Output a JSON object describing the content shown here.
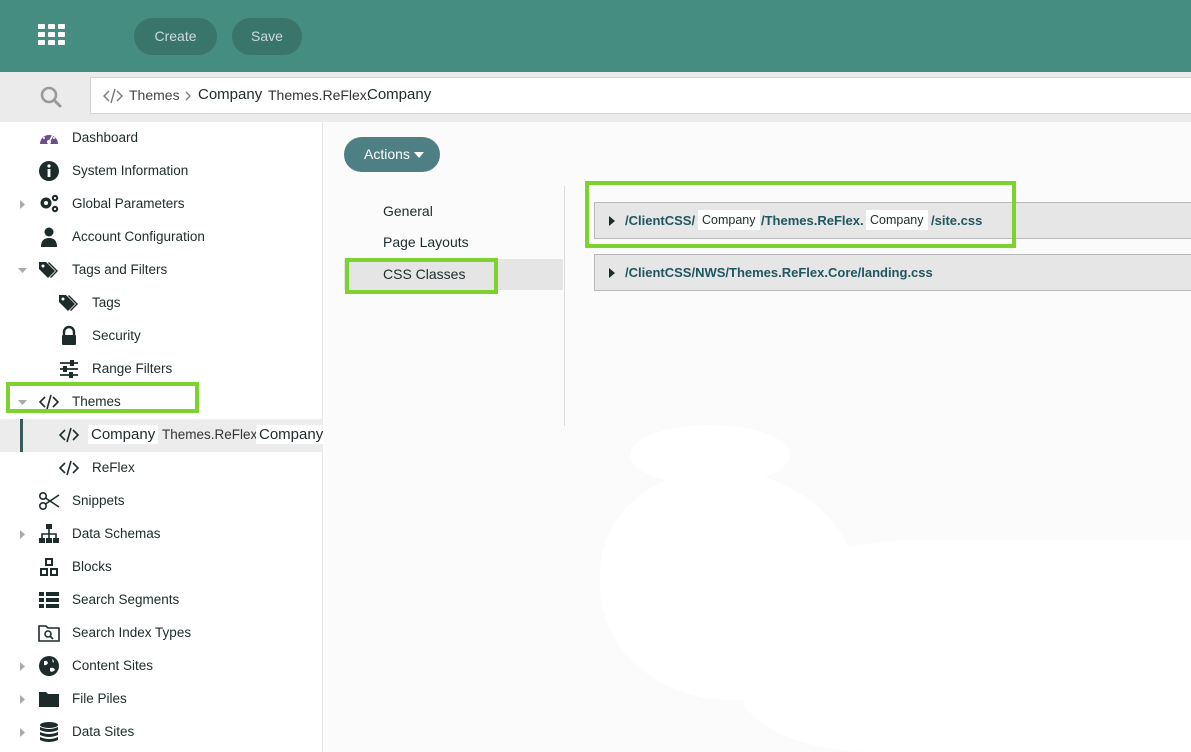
{
  "toolbar": {
    "create_label": "Create",
    "save_label": "Save"
  },
  "breadcrumb": {
    "item1": "Themes",
    "item2_a": "Company",
    "item2_b": "Themes.ReFlex.",
    "item2_c": "Company"
  },
  "sidebar": {
    "items": [
      {
        "label": "Dashboard",
        "icon": "dashboard-icon"
      },
      {
        "label": "System Information",
        "icon": "info-icon"
      },
      {
        "label": "Global Parameters",
        "icon": "gears-icon"
      },
      {
        "label": "Account Configuration",
        "icon": "user-icon"
      },
      {
        "label": "Tags and Filters",
        "icon": "tags-icon"
      },
      {
        "label": "Tags",
        "icon": "tags-icon"
      },
      {
        "label": "Security",
        "icon": "lock-icon"
      },
      {
        "label": "Range Filters",
        "icon": "sliders-icon"
      },
      {
        "label": "Themes",
        "icon": "code-icon"
      },
      {
        "label_a": "Company",
        "label_b": "Themes.ReFlex.",
        "label_c": "Company",
        "icon": "code-icon"
      },
      {
        "label": "ReFlex",
        "icon": "code-icon"
      },
      {
        "label": "Snippets",
        "icon": "scissors-icon"
      },
      {
        "label": "Data Schemas",
        "icon": "sitemap-icon"
      },
      {
        "label": "Blocks",
        "icon": "cubes-icon"
      },
      {
        "label": "Search Segments",
        "icon": "list-icon"
      },
      {
        "label": "Search Index Types",
        "icon": "search-folder-icon"
      },
      {
        "label": "Content Sites",
        "icon": "globe-icon"
      },
      {
        "label": "File Piles",
        "icon": "folder-icon"
      },
      {
        "label": "Data Sites",
        "icon": "database-icon"
      }
    ]
  },
  "main": {
    "actions_label": "Actions",
    "tabs": [
      {
        "label": "General"
      },
      {
        "label": "Page Layouts"
      },
      {
        "label": "CSS Classes"
      }
    ],
    "files": [
      {
        "prefix": "/ClientCSS/",
        "mask1": "Company",
        "middle": "/Themes.ReFlex.",
        "mask2": "Company",
        "suffix": "/site.css"
      },
      {
        "path": "/ClientCSS/NWS/Themes.ReFlex.Core/landing.css"
      }
    ]
  },
  "colors": {
    "header": "#468d81",
    "header_button": "#3a7569",
    "actions_button": "#4e7f85",
    "highlight": "#7dd32d",
    "path_text": "#1f5660"
  }
}
